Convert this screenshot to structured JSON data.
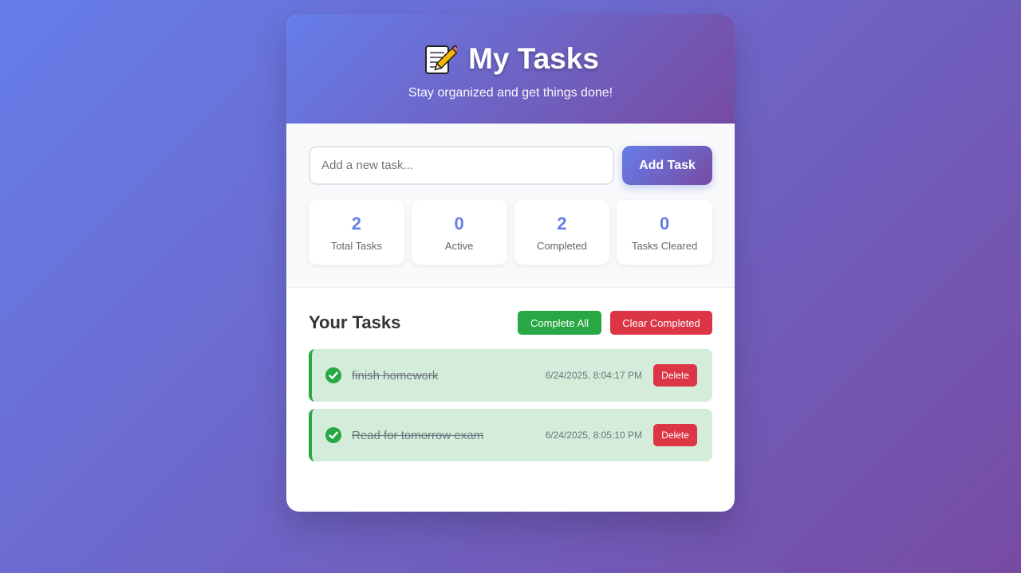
{
  "header": {
    "icon": "memo-icon",
    "title": "My Tasks",
    "subtitle": "Stay organized and get things done!"
  },
  "input": {
    "placeholder": "Add a new task...",
    "value": "",
    "add_label": "Add Task"
  },
  "stats": [
    {
      "value": "2",
      "label": "Total Tasks"
    },
    {
      "value": "0",
      "label": "Active"
    },
    {
      "value": "2",
      "label": "Completed"
    },
    {
      "value": "0",
      "label": "Tasks Cleared"
    }
  ],
  "list": {
    "title": "Your Tasks",
    "complete_all_label": "Complete All",
    "clear_completed_label": "Clear Completed",
    "tasks": [
      {
        "text": "finish homework",
        "timestamp": "6/24/2025, 8:04:17 PM",
        "completed": true,
        "delete_label": "Delete"
      },
      {
        "text": "Read for tomorrow exam",
        "timestamp": "6/24/2025, 8:05:10 PM",
        "completed": true,
        "delete_label": "Delete"
      }
    ]
  },
  "colors": {
    "gradient_start": "#667eea",
    "gradient_end": "#764ba2",
    "success": "#28a745",
    "danger": "#dc3545",
    "completed_bg": "#d4edda"
  }
}
